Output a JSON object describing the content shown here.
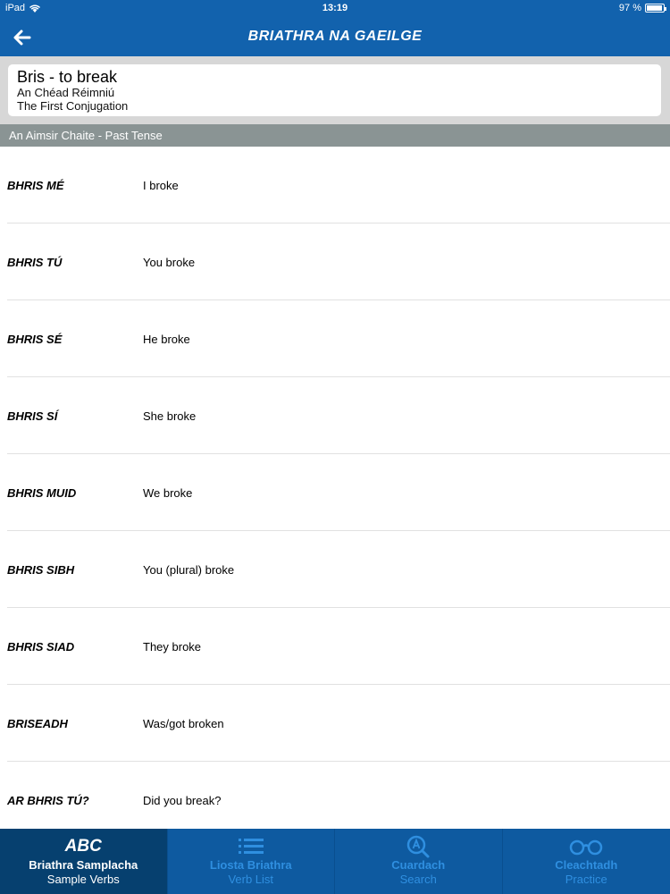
{
  "status": {
    "device": "iPad",
    "time": "13:19",
    "battery": "97 %",
    "battery_level": 0.97
  },
  "header": {
    "title": "BRIATHRA NA GAEILGE",
    "back_icon": "arrow-left-icon"
  },
  "verb": {
    "title": "Bris - to break",
    "group_irish": "An Chéad Réimniú",
    "group_english": "The First Conjugation"
  },
  "tense": {
    "label": "An Aimsir Chaite - Past Tense"
  },
  "conjugations": [
    {
      "irish": "BHRIS MÉ",
      "english": "I broke"
    },
    {
      "irish": "BHRIS TÚ",
      "english": "You broke"
    },
    {
      "irish": "BHRIS SÉ",
      "english": "He broke"
    },
    {
      "irish": "BHRIS SÍ",
      "english": "She broke"
    },
    {
      "irish": "BHRIS MUID",
      "english": "We broke"
    },
    {
      "irish": "BHRIS SIBH",
      "english": "You (plural) broke"
    },
    {
      "irish": "BHRIS SIAD",
      "english": "They broke"
    },
    {
      "irish": "BRISEADH",
      "english": "Was/got broken"
    },
    {
      "irish": "AR BHRIS TÚ?",
      "english": "Did you break?"
    }
  ],
  "tabs": [
    {
      "icon": "abc-icon",
      "icon_text": "ABC",
      "label": "Briathra Samplacha",
      "sub": "Sample Verbs",
      "active": true
    },
    {
      "icon": "list-icon",
      "label": "Liosta Briathra",
      "sub": "Verb List",
      "active": false
    },
    {
      "icon": "search-icon",
      "label": "Cuardach",
      "sub": "Search",
      "active": false
    },
    {
      "icon": "glasses-icon",
      "label": "Cleachtadh",
      "sub": "Practice",
      "active": false
    }
  ],
  "colors": {
    "primary": "#1262ad",
    "tab_active": "#06406f",
    "tab_inactive_text": "#2f8fe0",
    "tense_bar": "#8a9494"
  }
}
